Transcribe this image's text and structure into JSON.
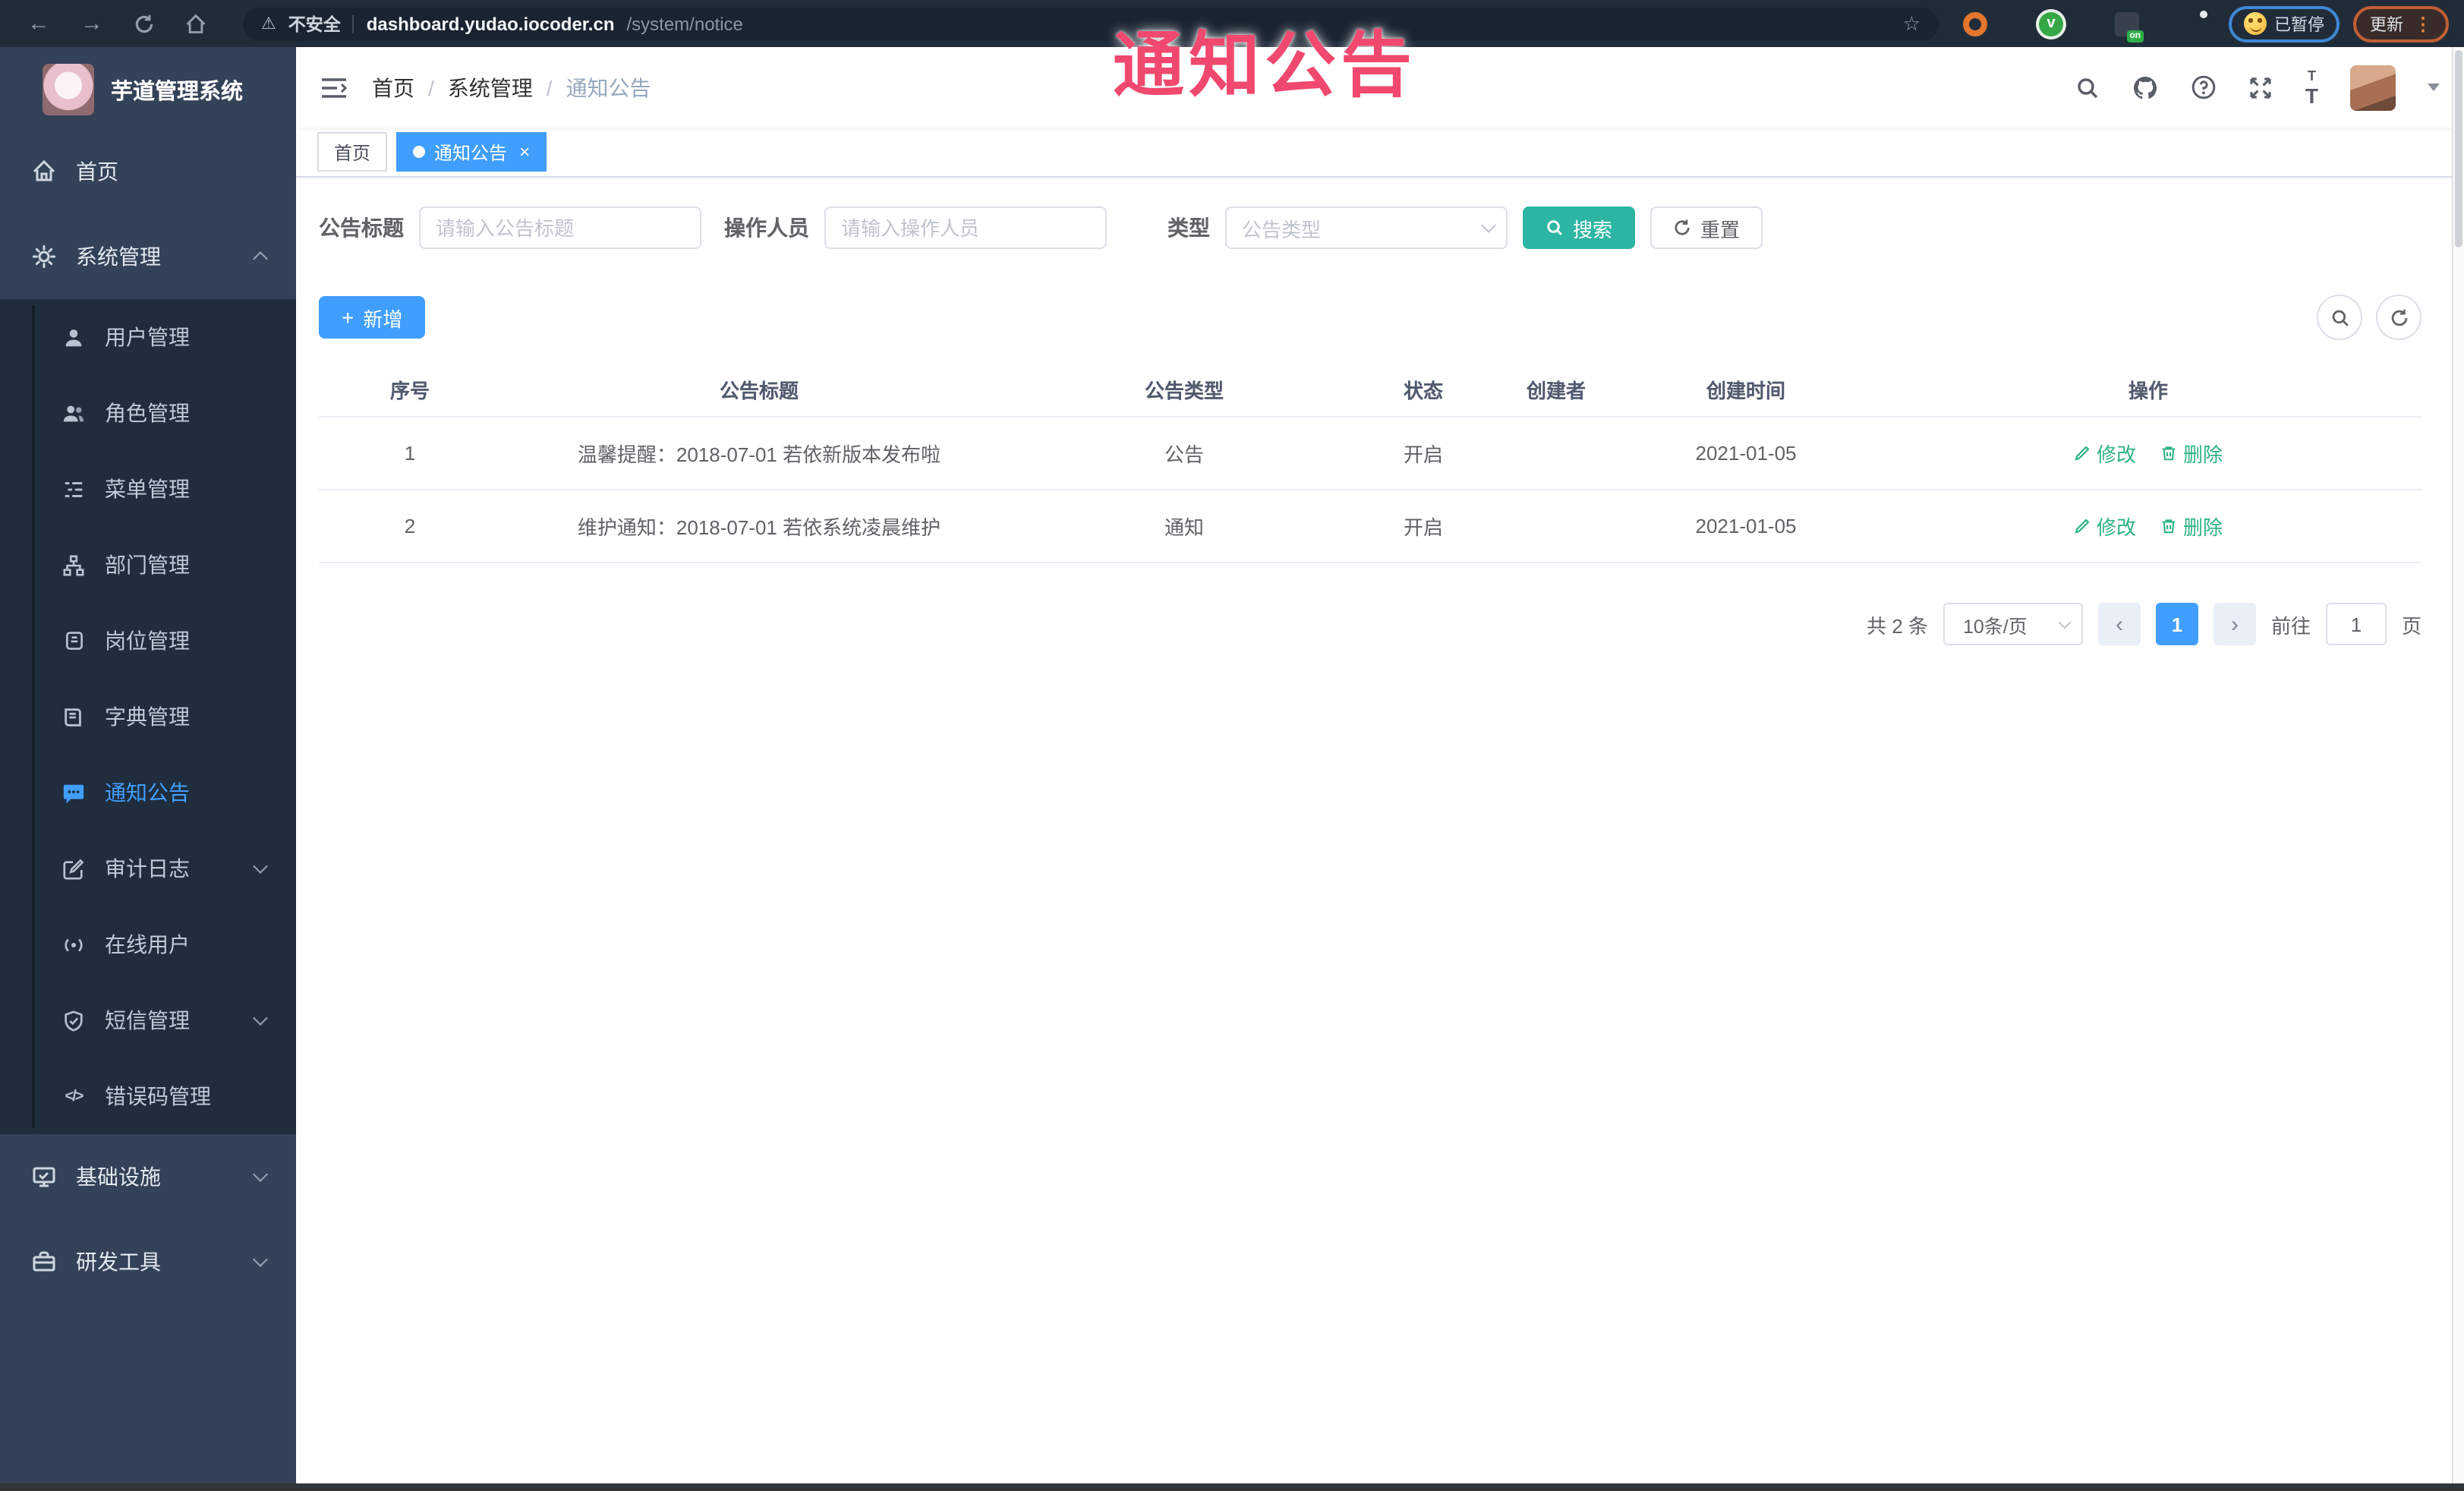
{
  "browser": {
    "security_text": "不安全",
    "url_host": "dashboard.yudao.iocoder.cn",
    "url_path": "/system/notice",
    "ext_badge": "on",
    "paused_text": "已暂停",
    "update_text": "更新"
  },
  "annotation": {
    "text": "通知公告"
  },
  "sidebar": {
    "title": "芋道管理系统",
    "top_items": [
      {
        "label": "首页"
      },
      {
        "label": "系统管理",
        "expanded": true
      },
      {
        "label": "基础设施"
      },
      {
        "label": "研发工具"
      }
    ],
    "system_children": [
      {
        "label": "用户管理"
      },
      {
        "label": "角色管理"
      },
      {
        "label": "菜单管理"
      },
      {
        "label": "部门管理"
      },
      {
        "label": "岗位管理"
      },
      {
        "label": "字典管理"
      },
      {
        "label": "通知公告",
        "active": true
      },
      {
        "label": "审计日志"
      },
      {
        "label": "在线用户"
      },
      {
        "label": "短信管理"
      },
      {
        "label": "错误码管理"
      }
    ]
  },
  "header": {
    "breadcrumb": [
      "首页",
      "系统管理",
      "通知公告"
    ]
  },
  "tabs": [
    {
      "label": "首页"
    },
    {
      "label": "通知公告",
      "close": "×"
    }
  ],
  "filters": {
    "title_label": "公告标题",
    "title_placeholder": "请输入公告标题",
    "operator_label": "操作人员",
    "operator_placeholder": "请输入操作人员",
    "type_label": "类型",
    "type_placeholder": "公告类型",
    "search_label": "搜索",
    "reset_label": "重置"
  },
  "toolbar": {
    "add_label": "新增",
    "plus": "+"
  },
  "table": {
    "headers": [
      "序号",
      "公告标题",
      "公告类型",
      "状态",
      "创建者",
      "创建时间",
      "操作"
    ],
    "rows": [
      {
        "no": "1",
        "title": "温馨提醒：2018-07-01 若依新版本发布啦",
        "type": "公告",
        "status": "开启",
        "creator": "",
        "time": "2021-01-05"
      },
      {
        "no": "2",
        "title": "维护通知：2018-07-01 若依系统凌晨维护",
        "type": "通知",
        "status": "开启",
        "creator": "",
        "time": "2021-01-05"
      }
    ],
    "actions": {
      "edit": "修改",
      "delete": "删除"
    }
  },
  "pagination": {
    "total": "共 2 条",
    "page_size": "10条/页",
    "current": "1",
    "prev": "‹",
    "next": "›",
    "goto_label": "前往",
    "goto_value": "1",
    "unit": "页"
  },
  "colors": {
    "primary": "#409eff",
    "search_button": "#2cb5a3",
    "action_link": "#2db380",
    "annotation": "#f0486e",
    "sidebar_bg": "#344258",
    "submenu_bg": "#1f2d3d",
    "browser_bar": "#212c39"
  }
}
